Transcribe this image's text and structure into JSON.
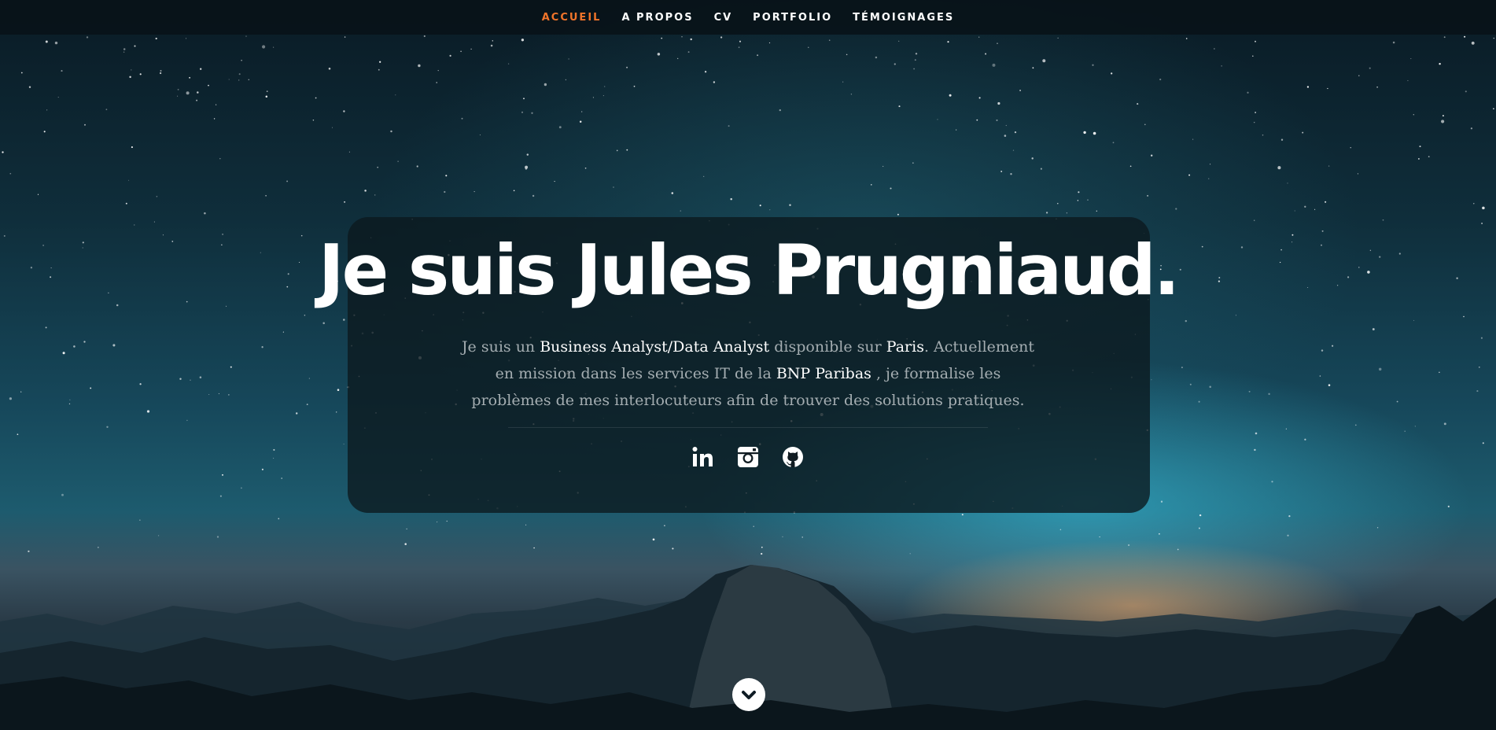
{
  "nav": {
    "items": [
      {
        "label": "ACCUEIL",
        "active": true
      },
      {
        "label": "A PROPOS",
        "active": false
      },
      {
        "label": "CV",
        "active": false
      },
      {
        "label": "PORTFOLIO",
        "active": false
      },
      {
        "label": "TÉMOIGNAGES",
        "active": false
      }
    ],
    "active_color": "#f0742a"
  },
  "hero": {
    "title": "Je suis Jules Prugniaud.",
    "intro": {
      "p1": "Je suis un ",
      "role": "Business Analyst/Data Analyst",
      "p2": " disponible sur ",
      "city": "Paris",
      "p3": ". Actuellement en mission dans les services IT de la ",
      "company": "BNP Paribas",
      "p4": " , je formalise les problèmes de mes interlocuteurs afin de trouver des solutions pratiques."
    },
    "social_icons": [
      "linkedin-icon",
      "instagram-icon",
      "github-icon"
    ]
  },
  "scroll_icon": "chevron-down-icon"
}
